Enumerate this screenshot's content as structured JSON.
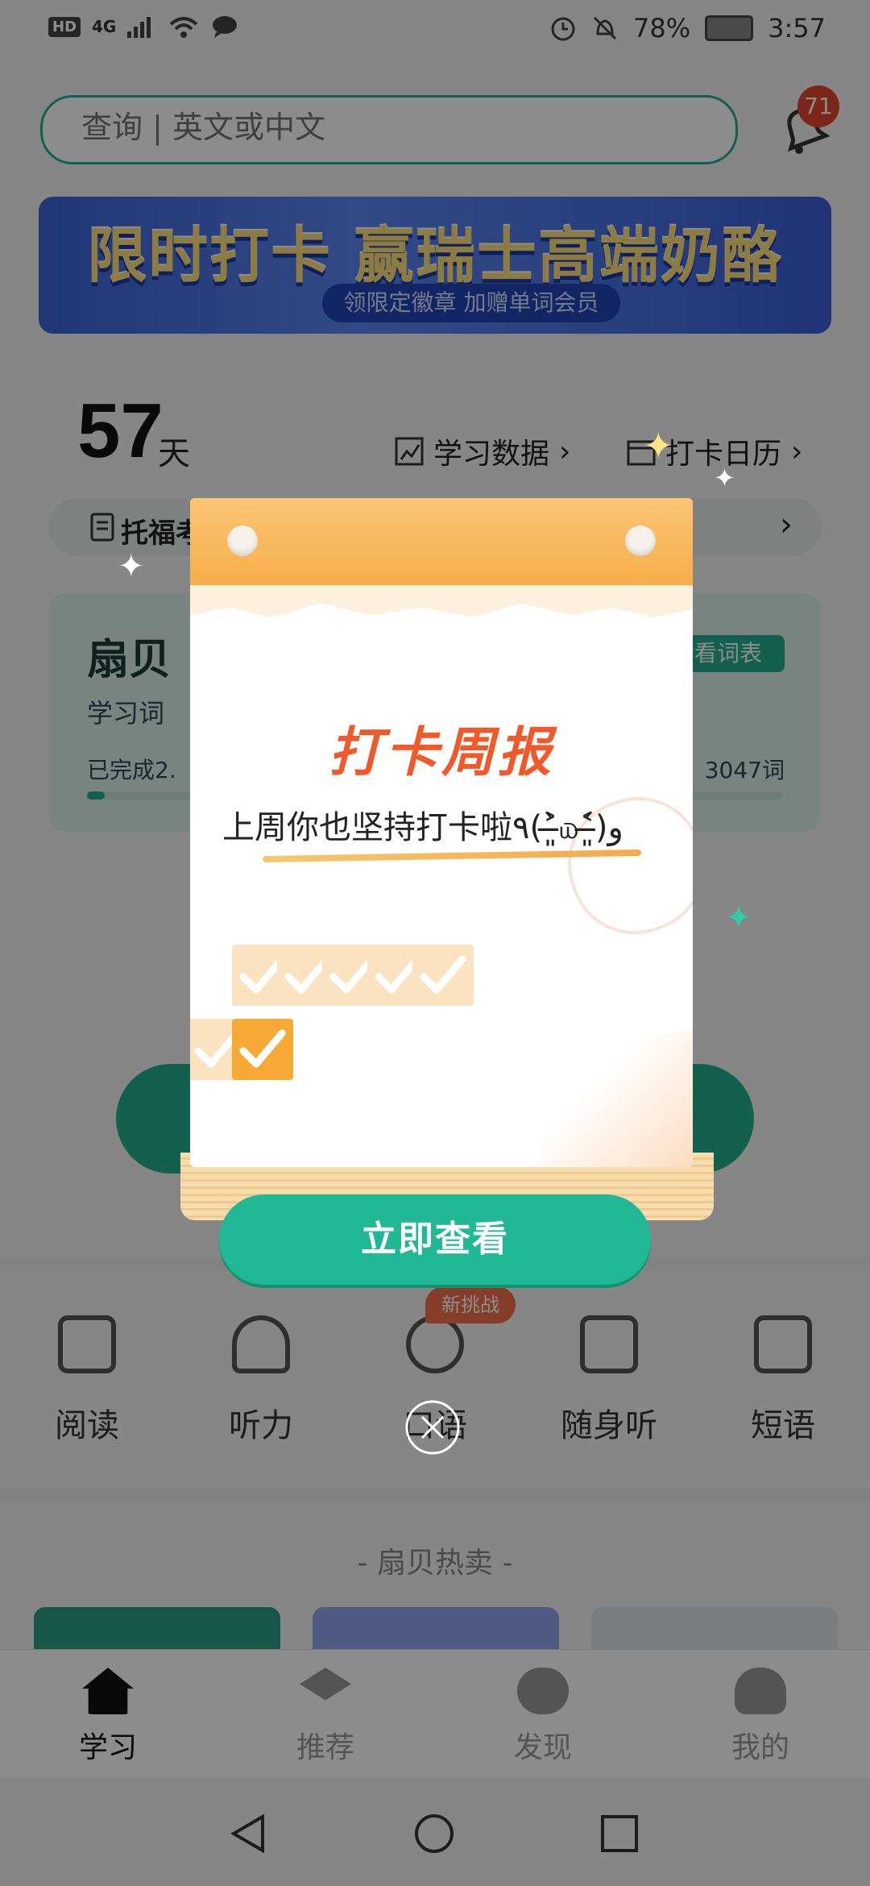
{
  "status_bar": {
    "network": "4G",
    "battery": "78%",
    "time": "3:57"
  },
  "search": {
    "placeholder": "查询 | 英文或中文"
  },
  "notifications": {
    "count": "71"
  },
  "banner": {
    "title": "限时打卡 赢瑞士高端奶酪",
    "subtitle": "领限定徽章 加赠单词会员"
  },
  "streak": {
    "days": "57",
    "unit": "天",
    "study_data_label": "学习数据",
    "calendar_label": "打卡日历"
  },
  "course": {
    "label": "托福考"
  },
  "book_card": {
    "name": "扇贝",
    "sub": "学习词",
    "done": "已完成2.",
    "total": "3047词",
    "chip": "看词表",
    "progress_fraction": 0.025
  },
  "tools": [
    {
      "label": "阅读",
      "icon": "book-icon"
    },
    {
      "label": "听力",
      "icon": "headphones-icon"
    },
    {
      "label": "口语",
      "icon": "speaker-person-icon"
    },
    {
      "label": "随身听",
      "icon": "audio-bars-icon"
    },
    {
      "label": "短语",
      "icon": "edit-note-icon"
    }
  ],
  "tools_newtag": "新挑战",
  "hot_section": {
    "title": "- 扇贝热卖 -"
  },
  "bottom_nav": [
    {
      "label": "学习",
      "active": true
    },
    {
      "label": "推荐",
      "active": false
    },
    {
      "label": "发现",
      "active": false
    },
    {
      "label": "我的",
      "active": false
    }
  ],
  "popup": {
    "title": "打卡周报",
    "subtitle": "上周你也坚持打卡啦٩(˃̶͈̀௰˂̶͈́)و",
    "checkins_done": 7,
    "cta": "立即查看"
  },
  "colors": {
    "accent": "#22b08c",
    "popup_title": "#f05a2a",
    "check_on": "#f7a935",
    "check_off": "#fbe3c1",
    "badge": "#e0452f"
  }
}
